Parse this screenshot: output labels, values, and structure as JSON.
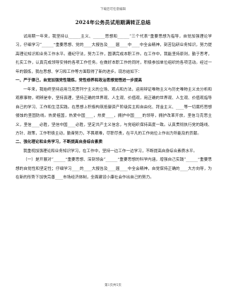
{
  "header_note": "下载后可任意编辑",
  "title": "2024年公务员试用期满转正总结",
  "paragraphs": [
    {
      "type": "body",
      "text": "试用期一年来，我坚持以______主义、______思想和______“三个代表”重要思想为指导，自觉加强理论学习，仔细学习“______”重要思想、党的____大报告及____届____中____中全会精神，刻苦钻研业务知识，努力提高理论知识和业务工作水平。遵纪守法，努力工作，圆满完成本职工作。在工作中，我能坚持原则，勤于思考，扎实工作，认真完成领导安排的各项工作任务。在做好本职工作的同时，积极参加单位组织的各项活动。经过一年的锻炼，我在思想、学习和工作等方面取得了新的进步。现总结如下："
    },
    {
      "type": "heading",
      "text": "一、严于律己，自觉加强党性锻炼，党性修养和政治思想觉悟进一步提高"
    },
    {
      "type": "body",
      "text": "一年来，我始终坚持运用马克思列宁主义的立场、观点和方法，运用辩证唯物主义与历史唯物主义去分析和观察事物，明辨是非，坚持真理，坚持正确的世界观、人生观、价值观，用正确的世界观、人生观、价值观指导自己的学习、工作和生活实践。在思想上积极构筑抵御资产阶级民主和自由化、拜金主义、____等一切腐朽思想侵蚀的坚固防线。热爱祖国，热爱中国____，热爱____，拥护中国____的领导，拥护改革开放，坚信马克思主义，坚信____必胜，坚信中国____必胜，坚定共产主义信念，与党组织保持高度一致。认真贯彻执行党的路线、方针、政策，工作积极主动，勤奋努力，不畏艰难，尽职尽责，在平凡的工作岗位上作出力所能及的贡献。"
    },
    {
      "type": "heading",
      "text": "二、强化理论和业务学习，不断提高自身综合素质"
    },
    {
      "type": "body",
      "text": "我重视加强理论和业务知识学习，在工作中，坚持一边工作一边学习，不断提高自身综合素质水平。"
    },
    {
      "type": "body",
      "text": "（一）是开展对“______”重要思想、深刻领会“______”重要思想的科学内涵，增强自己实践“______”重要思想的自觉性和坚定性；仔细学习____的____大报告及____届____中全会精神，自觉保持正确的____大方向导，为在新的形势下加快完善____市场经济体制，全面建设小康社会作出自己的努力。"
    }
  ],
  "footer": "第1页共5页"
}
